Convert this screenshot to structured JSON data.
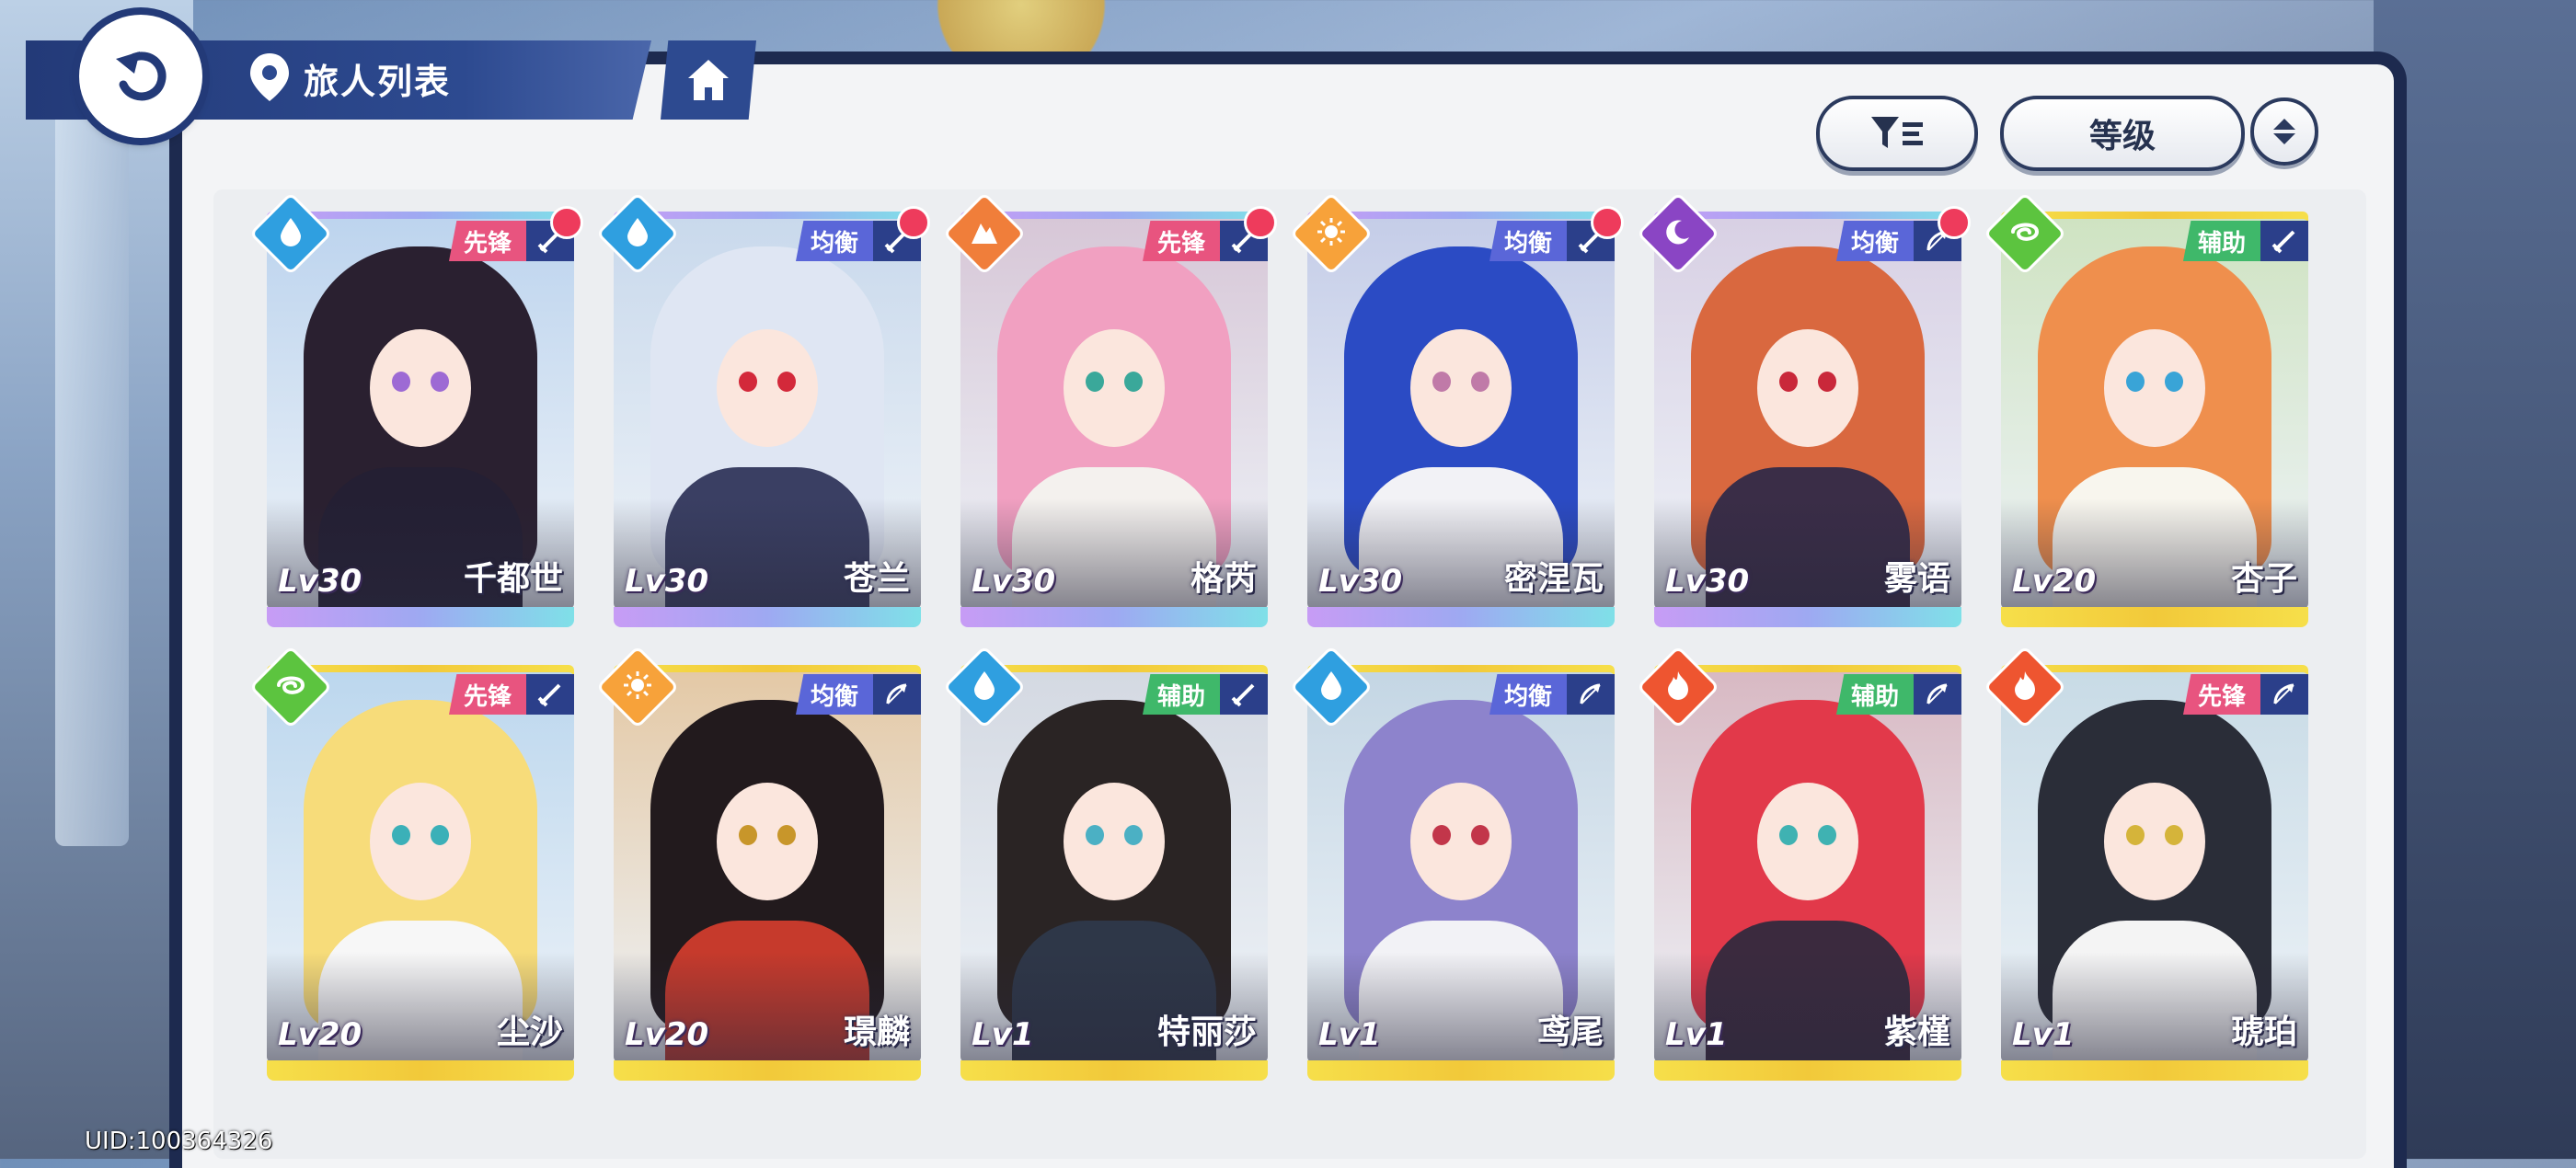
{
  "header": {
    "title": "旅人列表"
  },
  "toolbar": {
    "sort_label": "等级"
  },
  "colors": {
    "water": "#2f9fe0",
    "earth": "#f07e3a",
    "light": "#f7a23a",
    "dark": "#8a45c4",
    "wind": "#5cc43f",
    "fire": "#ee5530",
    "role_vanguard": "#e8547f",
    "role_balance": "#5a66d8",
    "role_support": "#3fb86a",
    "rarity_purple": "#b58cf0",
    "rarity_gold": "#f4d23c"
  },
  "characters": [
    {
      "name": "千都世",
      "level": "Lv30",
      "role": "先锋",
      "element": "water",
      "element_icon": "droplet-icon",
      "weapon_icon": "sword-icon",
      "rarity": "purple",
      "new": true,
      "hair": "#2a2030",
      "eye": "#9d6ad4",
      "outfit": "#241f33",
      "bg": "#bdd4ee"
    },
    {
      "name": "苍兰",
      "level": "Lv30",
      "role": "均衡",
      "element": "water",
      "element_icon": "droplet-icon",
      "weapon_icon": "sword-icon",
      "rarity": "purple",
      "new": true,
      "hair": "#dfe6f3",
      "eye": "#d3293a",
      "outfit": "#3a3f63",
      "bg": "#c9d9ec"
    },
    {
      "name": "格芮",
      "level": "Lv30",
      "role": "先锋",
      "element": "earth",
      "element_icon": "mountain-icon",
      "weapon_icon": "sword-icon",
      "rarity": "purple",
      "new": true,
      "hair": "#f1a0c1",
      "eye": "#3aa89a",
      "outfit": "#f4f1ee",
      "bg": "#d7c7d7"
    },
    {
      "name": "密涅瓦",
      "level": "Lv30",
      "role": "均衡",
      "element": "light",
      "element_icon": "sun-icon",
      "weapon_icon": "sword-icon",
      "rarity": "purple",
      "new": true,
      "hair": "#2b4bc4",
      "eye": "#c07aa8",
      "outfit": "#f2f2f6",
      "bg": "#c5cde8"
    },
    {
      "name": "雾语",
      "level": "Lv30",
      "role": "均衡",
      "element": "dark",
      "element_icon": "moon-icon",
      "weapon_icon": "bow-icon",
      "rarity": "purple",
      "new": true,
      "hair": "#d9683f",
      "eye": "#c9283a",
      "outfit": "#3a2d47",
      "bg": "#d8d0e4"
    },
    {
      "name": "杏子",
      "level": "Lv20",
      "role": "辅助",
      "element": "wind",
      "element_icon": "swirl-icon",
      "weapon_icon": "sword-icon",
      "rarity": "gold",
      "new": false,
      "hair": "#ef8f4d",
      "eye": "#39a4d7",
      "outfit": "#f8f6ee",
      "bg": "#cfe3c2"
    },
    {
      "name": "尘沙",
      "level": "Lv20",
      "role": "先锋",
      "element": "wind",
      "element_icon": "swirl-icon",
      "weapon_icon": "sword-icon",
      "rarity": "gold",
      "new": false,
      "hair": "#f7dc7a",
      "eye": "#3bb0b8",
      "outfit": "#f7f7f7",
      "bg": "#bcd7ee"
    },
    {
      "name": "璟麟",
      "level": "Lv20",
      "role": "均衡",
      "element": "light",
      "element_icon": "sun-icon",
      "weapon_icon": "bow-icon",
      "rarity": "gold",
      "new": false,
      "hair": "#221a1d",
      "eye": "#c8962a",
      "outfit": "#c63a2c",
      "bg": "#e4c9a6"
    },
    {
      "name": "特丽莎",
      "level": "Lv1",
      "role": "辅助",
      "element": "water",
      "element_icon": "droplet-icon",
      "weapon_icon": "sword-icon",
      "rarity": "gold",
      "new": false,
      "hair": "#2a2424",
      "eye": "#4bb0c4",
      "outfit": "#2e3748",
      "bg": "#d4d9e2"
    },
    {
      "name": "鸢尾",
      "level": "Lv1",
      "role": "均衡",
      "element": "water",
      "element_icon": "droplet-icon",
      "weapon_icon": "bow-icon",
      "rarity": "gold",
      "new": false,
      "hair": "#8d83cc",
      "eye": "#c2364a",
      "outfit": "#f2f2f6",
      "bg": "#c4d6e4"
    },
    {
      "name": "紫槿",
      "level": "Lv1",
      "role": "辅助",
      "element": "fire",
      "element_icon": "flame-icon",
      "weapon_icon": "bow-icon",
      "rarity": "gold",
      "new": false,
      "hair": "#e2394a",
      "eye": "#3fb2b2",
      "outfit": "#3b2a3e",
      "bg": "#d8b9c3"
    },
    {
      "name": "琥珀",
      "level": "Lv1",
      "role": "先锋",
      "element": "fire",
      "element_icon": "flame-icon",
      "weapon_icon": "bow-icon",
      "rarity": "gold",
      "new": false,
      "hair": "#2a2d38",
      "eye": "#d5b43a",
      "outfit": "#f4f4f4",
      "bg": "#c8dbe6"
    }
  ],
  "footer": {
    "uid": "UID:100364326"
  }
}
